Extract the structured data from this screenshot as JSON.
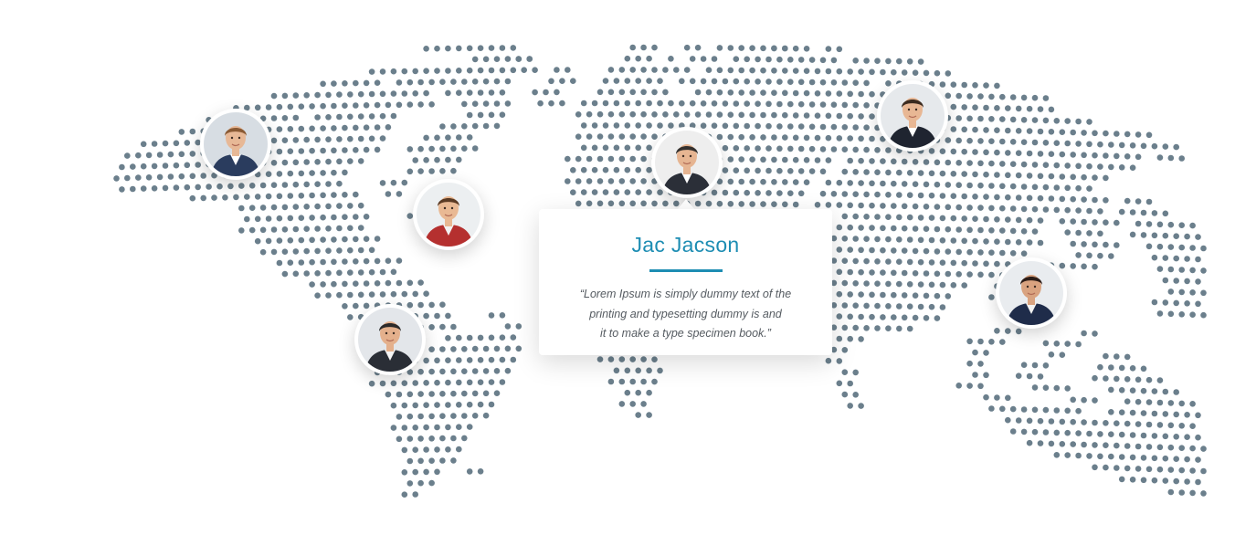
{
  "map": {
    "dot_color": "#6b7f8c",
    "land_rows": [
      {
        "r": 0,
        "spans": [
          [
            34,
            42
          ],
          [
            42,
            43
          ],
          [
            53,
            56
          ],
          [
            58,
            60
          ],
          [
            61,
            68
          ],
          [
            66,
            70
          ],
          [
            71,
            73
          ]
        ]
      },
      {
        "r": 1,
        "spans": [
          [
            38,
            44
          ],
          [
            42,
            44
          ],
          [
            52,
            55
          ],
          [
            56,
            57
          ],
          [
            58,
            61
          ],
          [
            62,
            68
          ],
          [
            68,
            72
          ],
          [
            73,
            80
          ]
        ]
      },
      {
        "r": 2,
        "spans": [
          [
            29,
            41
          ],
          [
            41,
            45
          ],
          [
            46,
            48
          ],
          [
            51,
            59
          ],
          [
            60,
            69
          ],
          [
            69,
            83
          ]
        ]
      },
      {
        "r": 3,
        "spans": [
          [
            24,
            30
          ],
          [
            31,
            42
          ],
          [
            45,
            48
          ],
          [
            50,
            56
          ],
          [
            57,
            75
          ],
          [
            76,
            87
          ]
        ]
      },
      {
        "r": 4,
        "spans": [
          [
            20,
            28
          ],
          [
            28,
            35
          ],
          [
            36,
            42
          ],
          [
            44,
            47
          ],
          [
            50,
            57
          ],
          [
            59,
            86
          ],
          [
            86,
            92
          ]
        ]
      },
      {
        "r": 5,
        "spans": [
          [
            16,
            25
          ],
          [
            25,
            35
          ],
          [
            37,
            42
          ],
          [
            44,
            47
          ],
          [
            48,
            80
          ],
          [
            81,
            92
          ]
        ]
      },
      {
        "r": 6,
        "spans": [
          [
            14,
            23
          ],
          [
            24,
            32
          ],
          [
            38,
            42
          ],
          [
            48,
            83
          ],
          [
            83,
            96
          ]
        ]
      },
      {
        "r": 7,
        "spans": [
          [
            11,
            22
          ],
          [
            22,
            31
          ],
          [
            35,
            41
          ],
          [
            48,
            80
          ],
          [
            80,
            101
          ]
        ]
      },
      {
        "r": 8,
        "spans": [
          [
            8,
            21
          ],
          [
            21,
            31
          ],
          [
            34,
            39
          ],
          [
            48,
            78
          ],
          [
            79,
            104
          ]
        ]
      },
      {
        "r": 9,
        "spans": [
          [
            6,
            30
          ],
          [
            32,
            39
          ],
          [
            48,
            74
          ],
          [
            74,
            100
          ],
          [
            101,
            104
          ]
        ]
      },
      {
        "r": 10,
        "spans": [
          [
            6,
            29
          ],
          [
            33,
            38
          ],
          [
            47,
            72
          ],
          [
            73,
            100
          ]
        ]
      },
      {
        "r": 11,
        "spans": [
          [
            5,
            27
          ],
          [
            32,
            37
          ],
          [
            47,
            71
          ],
          [
            72,
            97
          ]
        ]
      },
      {
        "r": 12,
        "spans": [
          [
            6,
            27
          ],
          [
            30,
            33
          ],
          [
            47,
            70
          ],
          [
            71,
            96
          ]
        ]
      },
      {
        "r": 13,
        "spans": [
          [
            12,
            28
          ],
          [
            30,
            32
          ],
          [
            47,
            69
          ],
          [
            70,
            97
          ],
          [
            98,
            101
          ]
        ]
      },
      {
        "r": 14,
        "spans": [
          [
            17,
            29
          ],
          [
            48,
            69
          ],
          [
            70,
            97
          ],
          [
            98,
            103
          ]
        ]
      },
      {
        "r": 15,
        "spans": [
          [
            17,
            29
          ],
          [
            32,
            34
          ],
          [
            49,
            71
          ],
          [
            72,
            91
          ],
          [
            92,
            98
          ],
          [
            99,
            105
          ]
        ]
      },
      {
        "r": 16,
        "spans": [
          [
            17,
            29
          ],
          [
            48,
            70
          ],
          [
            71,
            91
          ],
          [
            93,
            97
          ],
          [
            99,
            108
          ]
        ]
      },
      {
        "r": 17,
        "spans": [
          [
            18,
            30
          ],
          [
            49,
            69
          ],
          [
            70,
            91
          ],
          [
            93,
            98
          ],
          [
            100,
            109
          ]
        ]
      },
      {
        "r": 18,
        "spans": [
          [
            19,
            30
          ],
          [
            48,
            69
          ],
          [
            70,
            90
          ],
          [
            94,
            98
          ],
          [
            101,
            110
          ]
        ]
      },
      {
        "r": 19,
        "spans": [
          [
            20,
            32
          ],
          [
            47,
            69
          ],
          [
            70,
            89
          ],
          [
            90,
            96
          ],
          [
            101,
            111
          ]
        ]
      },
      {
        "r": 20,
        "spans": [
          [
            21,
            32
          ],
          [
            47,
            56
          ],
          [
            57,
            69
          ],
          [
            70,
            88
          ],
          [
            89,
            93
          ],
          [
            102,
            111
          ]
        ]
      },
      {
        "r": 21,
        "spans": [
          [
            23,
            34
          ],
          [
            47,
            55
          ],
          [
            57,
            66
          ],
          [
            66,
            84
          ],
          [
            86,
            92
          ],
          [
            102,
            110
          ]
        ]
      },
      {
        "r": 22,
        "spans": [
          [
            24,
            35
          ],
          [
            47,
            55
          ],
          [
            57,
            65
          ],
          [
            66,
            83
          ],
          [
            86,
            92
          ],
          [
            101,
            110
          ]
        ]
      },
      {
        "r": 23,
        "spans": [
          [
            26,
            36
          ],
          [
            47,
            55
          ],
          [
            59,
            64
          ],
          [
            67,
            82
          ],
          [
            87,
            91
          ],
          [
            101,
            108
          ]
        ]
      },
      {
        "r": 24,
        "spans": [
          [
            27,
            37
          ],
          [
            40,
            42
          ],
          [
            47,
            55
          ],
          [
            59,
            63
          ],
          [
            67,
            82
          ],
          [
            88,
            91
          ]
        ]
      },
      {
        "r": 25,
        "spans": [
          [
            28,
            37
          ],
          [
            41,
            43
          ],
          [
            48,
            55
          ],
          [
            68,
            79
          ],
          [
            86,
            89
          ],
          [
            94,
            96
          ]
        ]
      },
      {
        "r": 26,
        "spans": [
          [
            29,
            34
          ],
          [
            36,
            43
          ],
          [
            49,
            55
          ],
          [
            68,
            75
          ],
          [
            84,
            88
          ],
          [
            91,
            95
          ]
        ]
      },
      {
        "r": 27,
        "spans": [
          [
            29,
            43
          ],
          [
            49,
            56
          ],
          [
            70,
            73
          ],
          [
            84,
            86
          ],
          [
            91,
            93
          ],
          [
            96,
            99
          ]
        ]
      },
      {
        "r": 28,
        "spans": [
          [
            29,
            43
          ],
          [
            50,
            56
          ],
          [
            71,
            73
          ],
          [
            84,
            86
          ],
          [
            89,
            92
          ],
          [
            96,
            101
          ]
        ]
      },
      {
        "r": 29,
        "spans": [
          [
            29,
            42
          ],
          [
            51,
            56
          ],
          [
            72,
            74
          ],
          [
            84,
            86
          ],
          [
            88,
            91
          ],
          [
            95,
            102
          ]
        ]
      },
      {
        "r": 30,
        "spans": [
          [
            29,
            42
          ],
          [
            51,
            56
          ],
          [
            72,
            74
          ],
          [
            83,
            86
          ],
          [
            90,
            94
          ],
          [
            97,
            104
          ]
        ]
      },
      {
        "r": 31,
        "spans": [
          [
            30,
            41
          ],
          [
            52,
            55
          ],
          [
            72,
            74
          ],
          [
            85,
            88
          ],
          [
            93,
            96
          ],
          [
            98,
            105
          ]
        ]
      },
      {
        "r": 32,
        "spans": [
          [
            31,
            41
          ],
          [
            52,
            55
          ],
          [
            73,
            75
          ],
          [
            86,
            95
          ],
          [
            97,
            106
          ]
        ]
      },
      {
        "r": 33,
        "spans": [
          [
            31,
            40
          ],
          [
            53,
            55
          ],
          [
            87,
            105
          ]
        ]
      },
      {
        "r": 34,
        "spans": [
          [
            31,
            39
          ],
          [
            88,
            106
          ]
        ]
      },
      {
        "r": 35,
        "spans": [
          [
            31,
            38
          ],
          [
            89,
            106
          ]
        ]
      },
      {
        "r": 36,
        "spans": [
          [
            32,
            38
          ],
          [
            92,
            106
          ]
        ]
      },
      {
        "r": 37,
        "spans": [
          [
            32,
            37
          ],
          [
            95,
            106
          ]
        ]
      },
      {
        "r": 38,
        "spans": [
          [
            32,
            36
          ],
          [
            38,
            40
          ],
          [
            98,
            106
          ]
        ]
      },
      {
        "r": 39,
        "spans": [
          [
            32,
            35
          ],
          [
            102,
            106
          ]
        ]
      },
      {
        "r": 40,
        "spans": [
          [
            32,
            34
          ]
        ]
      }
    ]
  },
  "people": [
    {
      "id": "north-america-west",
      "bg": "#d7dde3",
      "skin": "#e7b896",
      "hair": "#8a5a34",
      "shirt": "#2a3c5e",
      "collar": "#ffffff"
    },
    {
      "id": "north-america-east",
      "bg": "#eceff1",
      "skin": "#e9b994",
      "hair": "#5a3a24",
      "shirt": "#b5302f",
      "collar": "#f2f2f2"
    },
    {
      "id": "south-america",
      "bg": "#e3e6ea",
      "skin": "#e4b08c",
      "hair": "#2c2a2a",
      "shirt": "#2a2e36",
      "collar": "#f5f5f5"
    },
    {
      "id": "europe-featured",
      "bg": "#eeeeee",
      "skin": "#e6b592",
      "hair": "#33302e",
      "shirt": "#2b2f38",
      "collar": "#ffffff"
    },
    {
      "id": "russia",
      "bg": "#e6e9ec",
      "skin": "#e8b794",
      "hair": "#3b2b20",
      "shirt": "#1f2430",
      "collar": "#ffffff"
    },
    {
      "id": "asia",
      "bg": "#e9ecef",
      "skin": "#d9a380",
      "hair": "#2c1d18",
      "shirt": "#1f2c4a",
      "collar": "#f2f2f2"
    }
  ],
  "card": {
    "name": "Jac Jacson",
    "quote_lines": [
      "“Lorem Ipsum is simply dummy text of the",
      "printing and typesetting dummy is  and",
      "it to make a type specimen book.”"
    ],
    "accent": "#1d8db3"
  }
}
